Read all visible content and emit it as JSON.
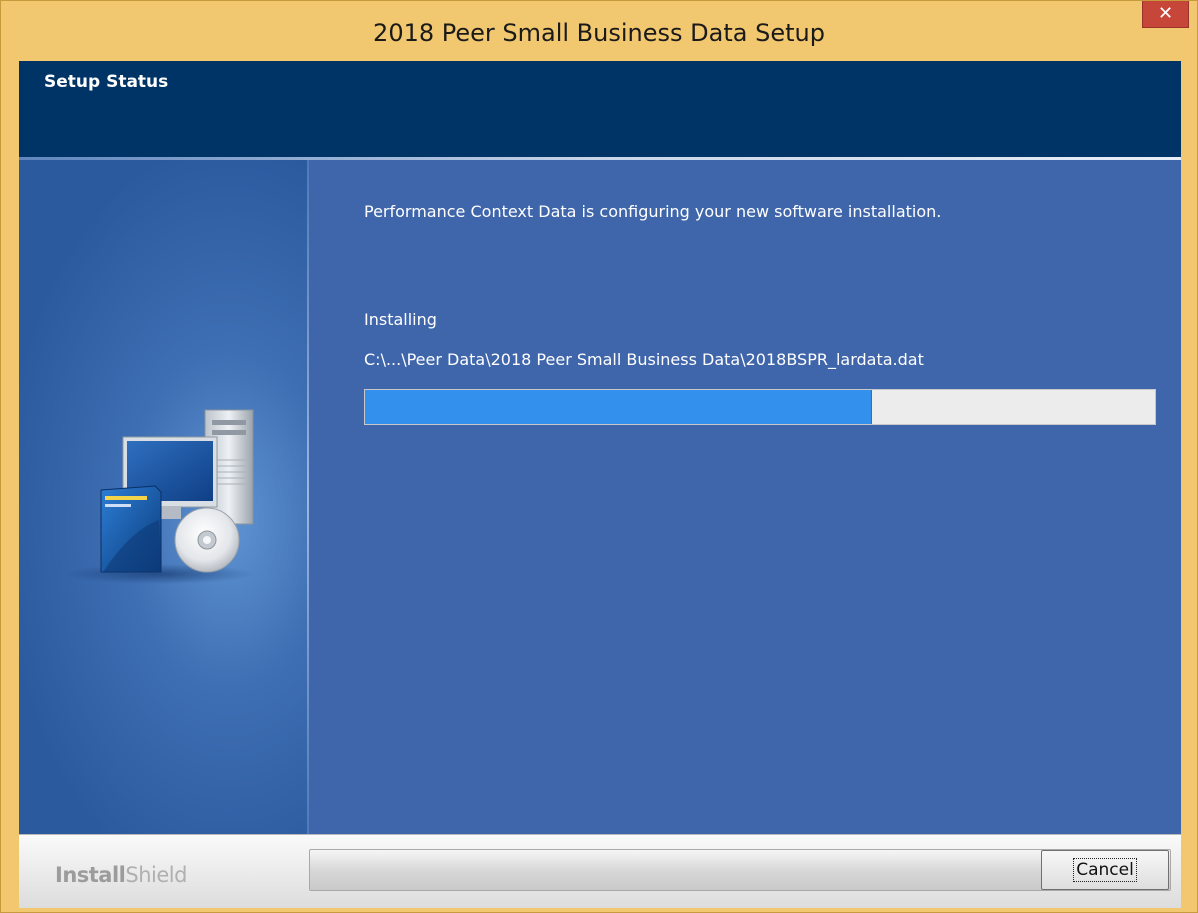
{
  "window": {
    "title": "2018 Peer Small Business Data Setup",
    "close_glyph": "✕"
  },
  "header": {
    "title": "Setup Status"
  },
  "main": {
    "intro": "Performance Context Data is configuring your new software installation.",
    "status_label": "Installing",
    "file_path": "C:\\...\\Peer Data\\2018 Peer Small Business Data\\2018BSPR_lardata.dat",
    "progress_fraction": 0.64
  },
  "footer": {
    "brand_part1": "Install",
    "brand_part2": "Shield",
    "cancel_label": "Cancel"
  },
  "icons": {
    "illustration": "computer-install-icon",
    "close": "close-icon"
  },
  "colors": {
    "title_bar": "#f1c76f",
    "header_bg": "#003366",
    "body_bg": "#3f65aa",
    "progress_fill": "#3390ec",
    "close_button": "#c7463a"
  }
}
